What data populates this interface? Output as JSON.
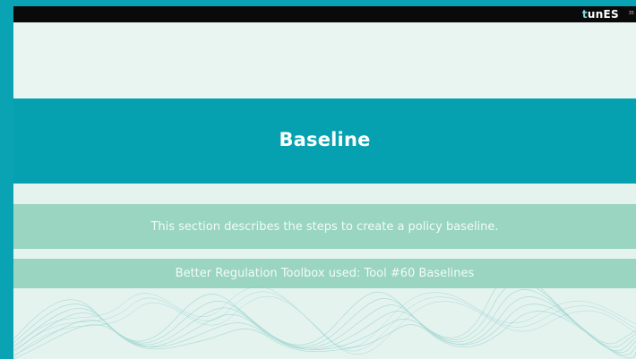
{
  "header": {
    "logo_prefix": "t",
    "logo_rest": "unES",
    "page_number": "35"
  },
  "main": {
    "title": "Baseline",
    "description": "This section describes the steps to create a policy baseline.",
    "toolbox_note": "Better Regulation Toolbox used: Tool #60 Baselines"
  },
  "colors": {
    "frame": "#0aa3b3",
    "title_band": "#06a1b0",
    "info_band": "#99d5c0",
    "slide_background": "#e5f3ef"
  }
}
